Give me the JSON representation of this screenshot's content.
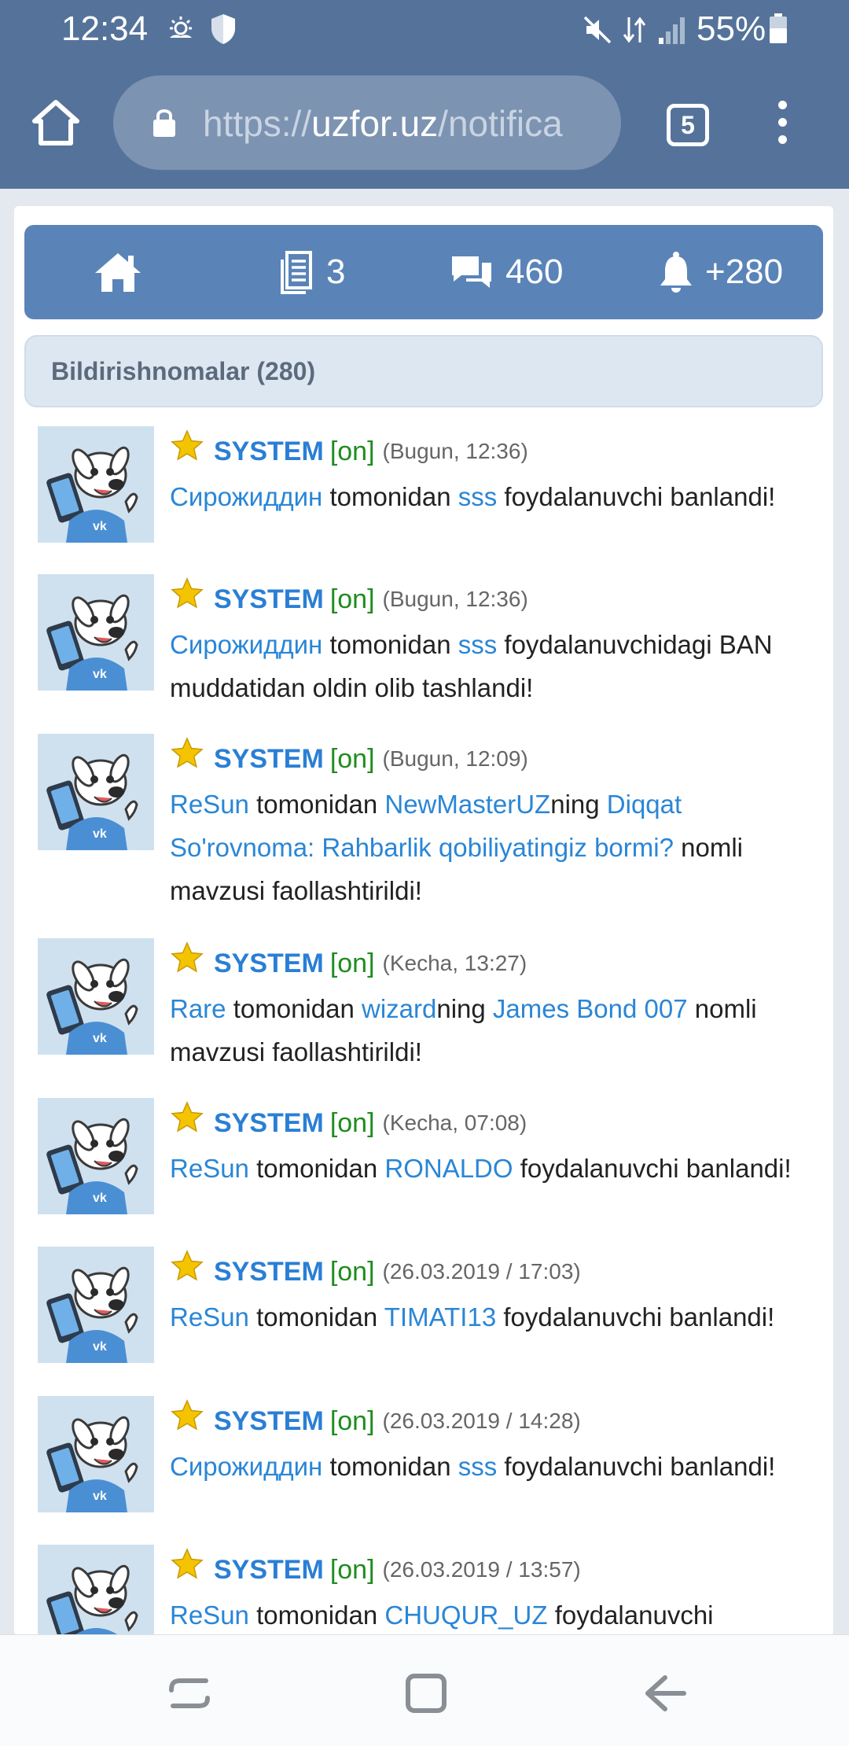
{
  "status_bar": {
    "time": "12:34",
    "battery": "55%",
    "icons": [
      "weather-icon",
      "shield-icon",
      "mute-icon",
      "data-icon",
      "signal-icon",
      "battery-icon"
    ]
  },
  "browser": {
    "url_prefix": "https://",
    "url_host": "uzfor.uz",
    "url_path": "/notifica",
    "tabs_count": "5"
  },
  "top_nav": {
    "docs_count": "3",
    "messages_count": "460",
    "notifications_count": "+280"
  },
  "section": {
    "title": "Bildirishnomalar (280)"
  },
  "colors": {
    "header_bg": "#55739a",
    "nav_bg": "#5a84b8",
    "link": "#2a86d6",
    "online": "#1e8c1e"
  },
  "notifications": [
    {
      "name": "SYSTEM",
      "status": "[on]",
      "time": "(Bugun, 12:36)",
      "parts": [
        {
          "t": "Сирожиддин",
          "link": true
        },
        {
          "t": " tomonidan ",
          "link": false
        },
        {
          "t": "sss",
          "link": true
        },
        {
          "t": " foydalanuvchi banlandi!",
          "link": false
        }
      ]
    },
    {
      "name": "SYSTEM",
      "status": "[on]",
      "time": "(Bugun, 12:36)",
      "parts": [
        {
          "t": "Сирожиддин",
          "link": true
        },
        {
          "t": " tomonidan ",
          "link": false
        },
        {
          "t": "sss",
          "link": true
        },
        {
          "t": " foydalanuvchidagi BAN muddatidan oldin olib tashlandi!",
          "link": false
        }
      ]
    },
    {
      "name": "SYSTEM",
      "status": "[on]",
      "time": "(Bugun, 12:09)",
      "parts": [
        {
          "t": "ReSun",
          "link": true
        },
        {
          "t": " tomonidan ",
          "link": false
        },
        {
          "t": "NewMasterUZ",
          "link": true
        },
        {
          "t": "ning ",
          "link": false
        },
        {
          "t": "Diqqat So'rovnoma: Rahbarlik qobiliyatingiz bormi?",
          "link": true
        },
        {
          "t": " nomli mavzusi faollashtirildi!",
          "link": false
        }
      ]
    },
    {
      "name": "SYSTEM",
      "status": "[on]",
      "time": "(Kecha, 13:27)",
      "parts": [
        {
          "t": "Rare",
          "link": true
        },
        {
          "t": " tomonidan ",
          "link": false
        },
        {
          "t": "wizard",
          "link": true
        },
        {
          "t": "ning ",
          "link": false
        },
        {
          "t": "James Bond 007",
          "link": true
        },
        {
          "t": " nomli mavzusi faollashtirildi!",
          "link": false
        }
      ]
    },
    {
      "name": "SYSTEM",
      "status": "[on]",
      "time": "(Kecha, 07:08)",
      "parts": [
        {
          "t": "ReSun",
          "link": true
        },
        {
          "t": " tomonidan ",
          "link": false
        },
        {
          "t": "RONALDO",
          "link": true
        },
        {
          "t": " foydalanuvchi banlandi!",
          "link": false
        }
      ]
    },
    {
      "name": "SYSTEM",
      "status": "[on]",
      "time": "(26.03.2019 / 17:03)",
      "parts": [
        {
          "t": "ReSun",
          "link": true
        },
        {
          "t": " tomonidan ",
          "link": false
        },
        {
          "t": "TIMATI13",
          "link": true
        },
        {
          "t": " foydalanuvchi banlandi!",
          "link": false
        }
      ]
    },
    {
      "name": "SYSTEM",
      "status": "[on]",
      "time": "(26.03.2019 / 14:28)",
      "parts": [
        {
          "t": "Сирожиддин",
          "link": true
        },
        {
          "t": " tomonidan ",
          "link": false
        },
        {
          "t": "sss",
          "link": true
        },
        {
          "t": " foydalanuvchi banlandi!",
          "link": false
        }
      ]
    },
    {
      "name": "SYSTEM",
      "status": "[on]",
      "time": "(26.03.2019 / 13:57)",
      "parts": [
        {
          "t": "ReSun",
          "link": true
        },
        {
          "t": " tomonidan ",
          "link": false
        },
        {
          "t": "CHUQUR_UZ",
          "link": true
        },
        {
          "t": " foydalanuvchi",
          "link": false
        }
      ]
    }
  ]
}
